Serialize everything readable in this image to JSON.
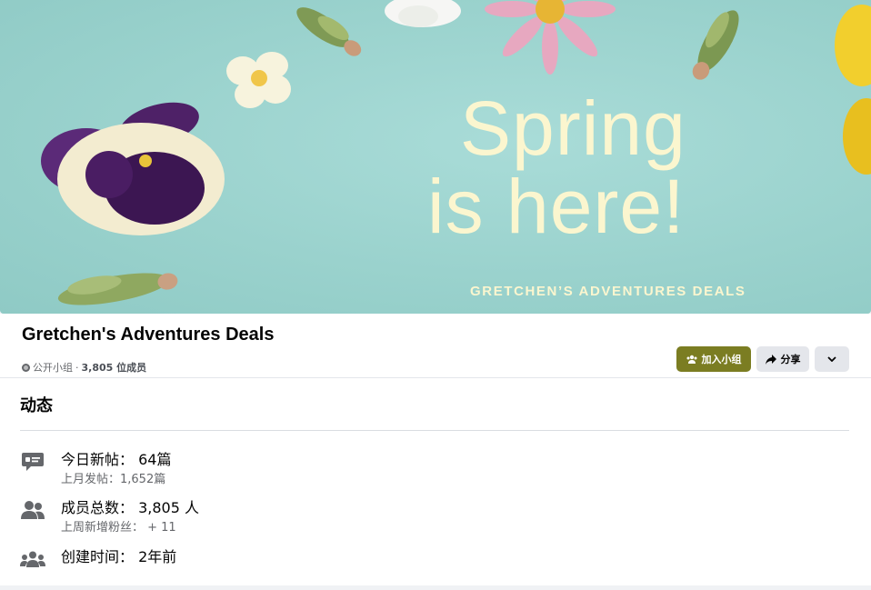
{
  "cover": {
    "headline_line1": "Spring",
    "headline_line2": "is here!",
    "subtitle": "GRETCHEN’S ADVENTURES DEALS",
    "background_color": "#9fd6d2",
    "text_color": "#fbf6cf"
  },
  "group": {
    "name": "Gretchen's Adventures Deals",
    "privacy_label": "公开小组",
    "separator": "·",
    "members_label": "3,805 位成员"
  },
  "actions": {
    "join_label": "加入小组",
    "share_label": "分享",
    "join_color": "#7b7d22"
  },
  "about": {
    "section_title": "动态",
    "stats": [
      {
        "icon": "chat-bubble-icon",
        "main": "今日新帖： 64篇",
        "sub": "上月发帖：1,652篇"
      },
      {
        "icon": "members-icon",
        "main": "成员总数： 3,805 人",
        "sub": "上周新增粉丝： + 11"
      },
      {
        "icon": "group-icon",
        "main": "创建时间： 2年前",
        "sub": ""
      }
    ]
  }
}
